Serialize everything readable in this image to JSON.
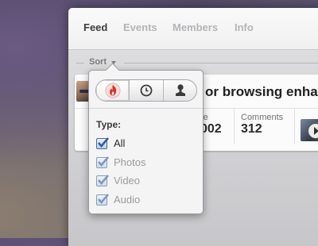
{
  "tabs": [
    {
      "label": "Feed",
      "active": true
    },
    {
      "label": "Events",
      "active": false
    },
    {
      "label": "Members",
      "active": false
    },
    {
      "label": "Info",
      "active": false
    }
  ],
  "sort": {
    "label": "Sort"
  },
  "post": {
    "title": "or browsing enhance",
    "stats": [
      {
        "label": "re",
        "value": "002"
      },
      {
        "label": "Comments",
        "value": "312"
      }
    ]
  },
  "sort_popover": {
    "segments": [
      {
        "icon": "flame-icon",
        "selected": true
      },
      {
        "icon": "clock-icon",
        "selected": false
      },
      {
        "icon": "person-icon",
        "selected": false
      }
    ],
    "type_label": "Type:",
    "options": [
      {
        "label": "All",
        "checked": true
      },
      {
        "label": "Photos",
        "checked": true
      },
      {
        "label": "Video",
        "checked": true
      },
      {
        "label": "Audio",
        "checked": true
      }
    ]
  },
  "colors": {
    "flame": "#d9342b",
    "check": "#2f5d9e",
    "check_dim": "#7f97bd"
  }
}
